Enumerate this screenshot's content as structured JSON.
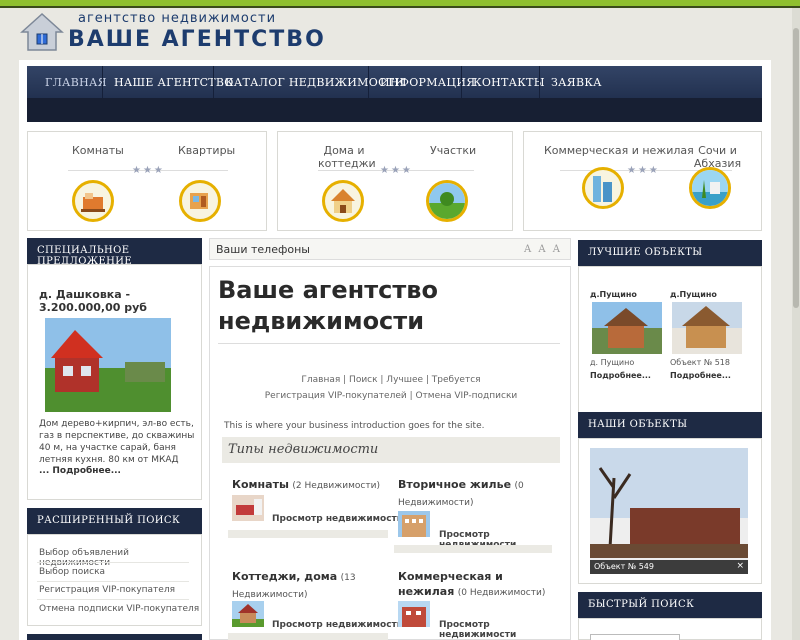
{
  "header": {
    "tagline": "агентство недвижимости",
    "title": "ВАШЕ АГЕНТСТВО"
  },
  "nav": {
    "items": [
      {
        "label": "ГЛАВНАЯ",
        "active": true
      },
      {
        "label": "НАШЕ АГЕНТСТВО",
        "active": false
      },
      {
        "label": "КАТАЛОГ НЕДВИЖИМОСТИ",
        "active": false
      },
      {
        "label": "ИНФОРМАЦИЯ",
        "active": false
      },
      {
        "label": "КОНТАКТЫ",
        "active": false
      },
      {
        "label": "ЗАЯВКА",
        "active": false
      }
    ]
  },
  "categories": [
    {
      "left": "Комнаты",
      "right": "Квартиры"
    },
    {
      "left": "Дома и коттеджи",
      "right": "Участки"
    },
    {
      "left": "Коммерческая и нежилая",
      "right": "Сочи и Абхазия"
    }
  ],
  "special": {
    "heading": "СПЕЦИАЛЬНОЕ ПРЕДЛОЖЕНИЕ",
    "title": "д. Дашковка - 3.200.000,00 руб",
    "text": "Дом дерево+кирпич, эл-во есть, газ в перспективе, до скважины 40 м, на участке сарай, баня летняя кухня. 80 км от МКАД",
    "more": "... Подробнее..."
  },
  "search_panel": {
    "heading": "РАСШИРЕННЫЙ ПОИСК",
    "items": [
      "Выбор объявлений недвижимости",
      "Выбор поиска",
      "Регистрация VIP-покупателя",
      "Отмена подписки VIP-покупателя"
    ]
  },
  "center": {
    "phones": "Ваши  телефоны",
    "font_controls": "A A A",
    "h1": "Ваше агентство недвижимости",
    "links1": "Главная | Поиск | Лучшее | Требуется",
    "links2": "Регистрация VIP-покупателей | Отмена VIP-подписки",
    "intro": "This is where your business introduction goes for the site.",
    "types_heading": "Типы недвижимости",
    "types": [
      {
        "name": "Комнаты",
        "count": "(2 Недвижимости)",
        "link": "Просмотр недвижимости"
      },
      {
        "name": "Вторичное жилье",
        "count": "(0 Недвижимости)",
        "link": "Просмотр недвижимости"
      },
      {
        "name": "Коттеджи, дома",
        "count": "(13 Недвижимости)",
        "link": "Просмотр недвижимости"
      },
      {
        "name": "Коммерческая и нежилая",
        "count": "(0 Недвижимости)",
        "link": "Просмотр недвижимости"
      }
    ]
  },
  "best": {
    "heading": "ЛУЧШИЕ ОБЪЕКТЫ",
    "items": [
      {
        "name": "д.Пущино",
        "caption": "д. Пущино",
        "more": "Подробнее..."
      },
      {
        "name": "д.Пущино",
        "caption": "Объект № 518",
        "more": "Подробнее..."
      }
    ]
  },
  "objects": {
    "heading": "НАШИ ОБЪЕКТЫ",
    "caption": "Объект № 549",
    "close": "×"
  },
  "quick": {
    "heading": "БЫСТРЫЙ ПОИСК"
  }
}
